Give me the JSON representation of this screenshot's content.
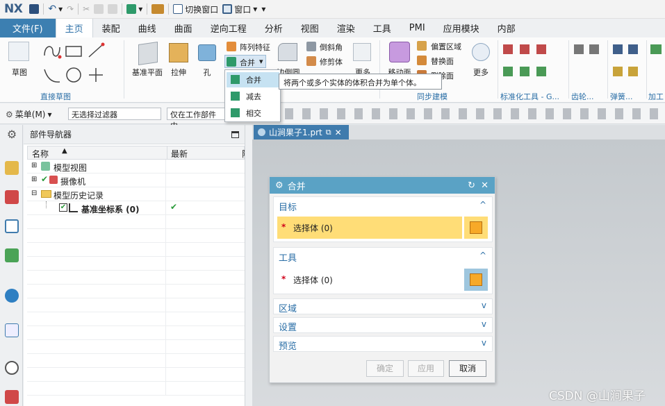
{
  "app": {
    "logo": "NX"
  },
  "quickbar": {
    "switch_window": "切换窗口",
    "window": "窗口"
  },
  "tabs": [
    "文件(F)",
    "主页",
    "装配",
    "曲线",
    "曲面",
    "逆向工程",
    "分析",
    "视图",
    "渲染",
    "工具",
    "PMI",
    "应用模块",
    "内部"
  ],
  "ribbon": {
    "sketch": "草图",
    "group_direct_sketch": "直接草图",
    "datum_plane": "基准平面",
    "extrude": "拉伸",
    "hole": "孔",
    "pattern_feature": "阵列特征",
    "unite": "合并",
    "edge_blend": "边倒圆",
    "chamfer": "倒斜角",
    "trim_body": "修剪体",
    "more": "更多",
    "move_face": "移动面",
    "offset_region": "偏置区域",
    "replace_face": "替换面",
    "delete_face": "删除面",
    "group_sync": "同步建模",
    "more2": "更多",
    "group_std": "标准化工具 - G...",
    "group_gear": "齿轮...",
    "group_spring": "弹簧...",
    "group_machining": "加工"
  },
  "toolbar2": {
    "menu": "菜单(M)",
    "filter": "无选择过滤器",
    "scope": "仅在工作部件内"
  },
  "navigator": {
    "title": "部件导航器",
    "col_name": "名称",
    "col_latest": "最新",
    "col_extra": "附",
    "rows": [
      {
        "label": "模型视图"
      },
      {
        "label": "摄像机"
      },
      {
        "label": "模型历史记录"
      },
      {
        "label": "基准坐标系 (0)"
      }
    ]
  },
  "document": {
    "tab": "山涧果子1.prt"
  },
  "dropdown": {
    "items": [
      "合并",
      "减去",
      "相交"
    ]
  },
  "tooltip": "将两个或多个实体的体积合并为单个体。",
  "dialog": {
    "title": "合并",
    "target": {
      "title": "目标",
      "select": "选择体 (0)"
    },
    "tool": {
      "title": "工具",
      "select": "选择体 (0)"
    },
    "region": "区域",
    "settings": "设置",
    "preview": "预览",
    "ok": "确定",
    "apply": "应用",
    "cancel": "取消"
  },
  "watermark": "CSDN @山涧果子",
  "colors": {
    "accent": "#3c7fb1",
    "dialog_title": "#5aa2c5",
    "highlight": "#ffdd77",
    "required": "#d0021b"
  }
}
